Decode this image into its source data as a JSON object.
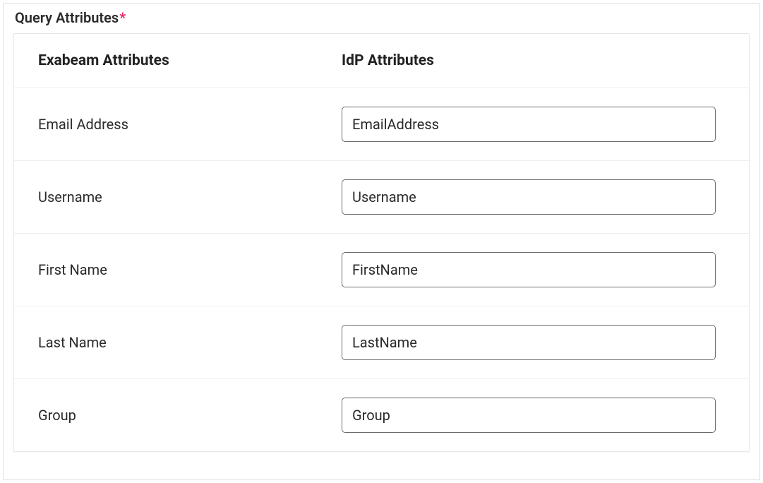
{
  "section": {
    "title": "Query Attributes",
    "required_marker": "*"
  },
  "table": {
    "headers": {
      "left": "Exabeam Attributes",
      "right": "IdP Attributes"
    },
    "rows": [
      {
        "label": "Email Address",
        "value": "EmailAddress"
      },
      {
        "label": "Username",
        "value": "Username"
      },
      {
        "label": "First Name",
        "value": "FirstName"
      },
      {
        "label": "Last Name",
        "value": "LastName"
      },
      {
        "label": "Group",
        "value": "Group"
      }
    ]
  }
}
